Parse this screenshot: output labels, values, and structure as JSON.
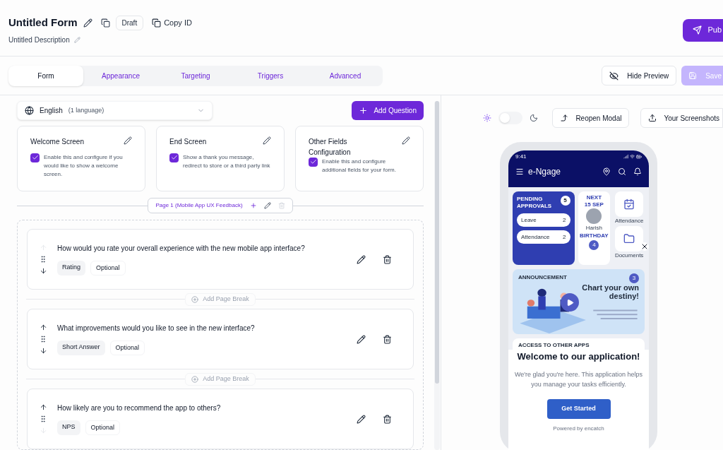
{
  "form": {
    "title": "Untitled Form",
    "status": "Draft",
    "copy_id": "Copy ID",
    "description": "Untitled Description"
  },
  "publish_button": "Pub",
  "tabs": [
    {
      "label": "Form",
      "selected": true
    },
    {
      "label": "Appearance",
      "selected": false
    },
    {
      "label": "Targeting",
      "selected": false
    },
    {
      "label": "Triggers",
      "selected": false
    },
    {
      "label": "Advanced",
      "selected": false
    }
  ],
  "hide_preview_button": "Hide Preview",
  "save_button": {
    "label": "Save",
    "disabled": true
  },
  "language": {
    "name": "English",
    "count": "(1 language)"
  },
  "add_question_button": "Add Question",
  "screen_cards": [
    {
      "title": "Welcome Screen",
      "checked": true,
      "description": "Enable this and configure if you would like to show a welcome screen."
    },
    {
      "title": "End Screen",
      "checked": true,
      "description": "Show a thank you message, redirect to store or a third party link"
    },
    {
      "title": "Other Fields Configuration",
      "checked": true,
      "description": "Enable this and configure additional fields for your form."
    }
  ],
  "page": {
    "label": "Page 1 (Mobile App UX Feedback)"
  },
  "questions": [
    {
      "text": "How would you rate your overall experience with the new mobile app interface?",
      "type": "Rating",
      "requirement": "Optional",
      "can_move_up": false,
      "can_move_down": true
    },
    {
      "text": "What improvements would you like to see in the new interface?",
      "type": "Short Answer",
      "requirement": "Optional",
      "can_move_up": true,
      "can_move_down": true
    },
    {
      "text": "How likely are you to recommend the app to others?",
      "type": "NPS",
      "requirement": "Optional",
      "can_move_up": true,
      "can_move_down": false
    }
  ],
  "page_breaks": [
    "Add Page Break",
    "Add Page Break"
  ],
  "preview": {
    "dark_mode": false,
    "reopen_modal_button": "Reopen Modal",
    "screenshots_button": "Your Screenshots",
    "phone": {
      "time": "9:41",
      "app_name": "e-Ngage",
      "pending": {
        "title": "PENDING APPROVALS",
        "count": "5",
        "items": [
          {
            "label": "Leave",
            "count": "2"
          },
          {
            "label": "Attendance",
            "count": "2"
          }
        ]
      },
      "birthday": {
        "label": "NEXT",
        "date": "15 SEP",
        "name": "Harish",
        "kind": "BIRTHDAY",
        "count": "4"
      },
      "tiles": [
        "Attendance",
        "Documents"
      ],
      "announcement": {
        "title": "ANNOUNCEMENT",
        "count": "3",
        "headline": "Chart your own destiny!"
      },
      "access_title": "ACCESS TO OTHER APPS",
      "modal": {
        "title": "Welcome to our application!",
        "text": "We're glad you're here. This application helps you manage your tasks efficiently.",
        "button": "Get Started",
        "footer": "Powered by encatch"
      }
    }
  }
}
